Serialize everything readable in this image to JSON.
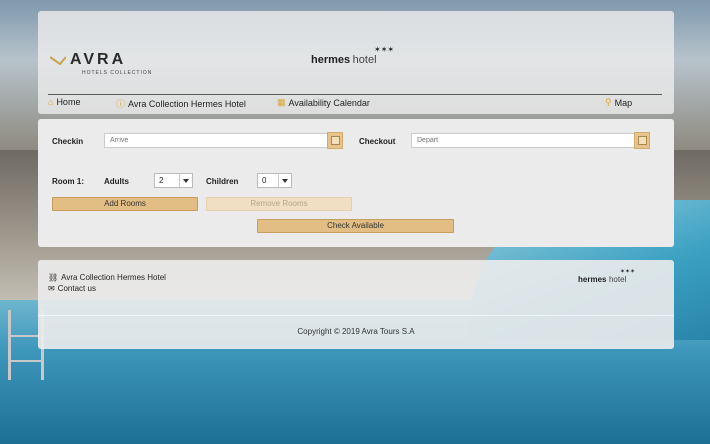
{
  "header": {
    "avra_logo_text": "AVRA",
    "avra_logo_sub": "HOTELS COLLECTION",
    "hermes_logo_bold": "hermes",
    "hermes_logo_light": "hotel",
    "nav": [
      {
        "label": "Home",
        "icon": "home-icon"
      },
      {
        "label": "Avra Collection Hermes Hotel",
        "icon": "info-icon"
      },
      {
        "label": "Availability Calendar",
        "icon": "calendar-icon"
      },
      {
        "label": "Map",
        "icon": "map-pin-icon"
      }
    ]
  },
  "booking": {
    "checkin_label": "Checkin",
    "checkin_placeholder": "Arrive",
    "checkout_label": "Checkout",
    "checkout_placeholder": "Depart",
    "room_label": "Room 1:",
    "adults_label": "Adults",
    "adults_value": "2",
    "children_label": "Children",
    "children_value": "0",
    "add_rooms": "Add Rooms",
    "remove_rooms": "Remove Rooms",
    "check_available": "Check Available"
  },
  "footer": {
    "hotel_link": "Avra Collection Hermes Hotel",
    "contact_link": "Contact us",
    "copyright": "Copyright © 2019 Avra Tours S.A",
    "hermes_logo_bold": "hermes",
    "hermes_logo_light": "hotel"
  },
  "colors": {
    "accent": "#e3be84",
    "nav_icon": "#d9a63a"
  }
}
